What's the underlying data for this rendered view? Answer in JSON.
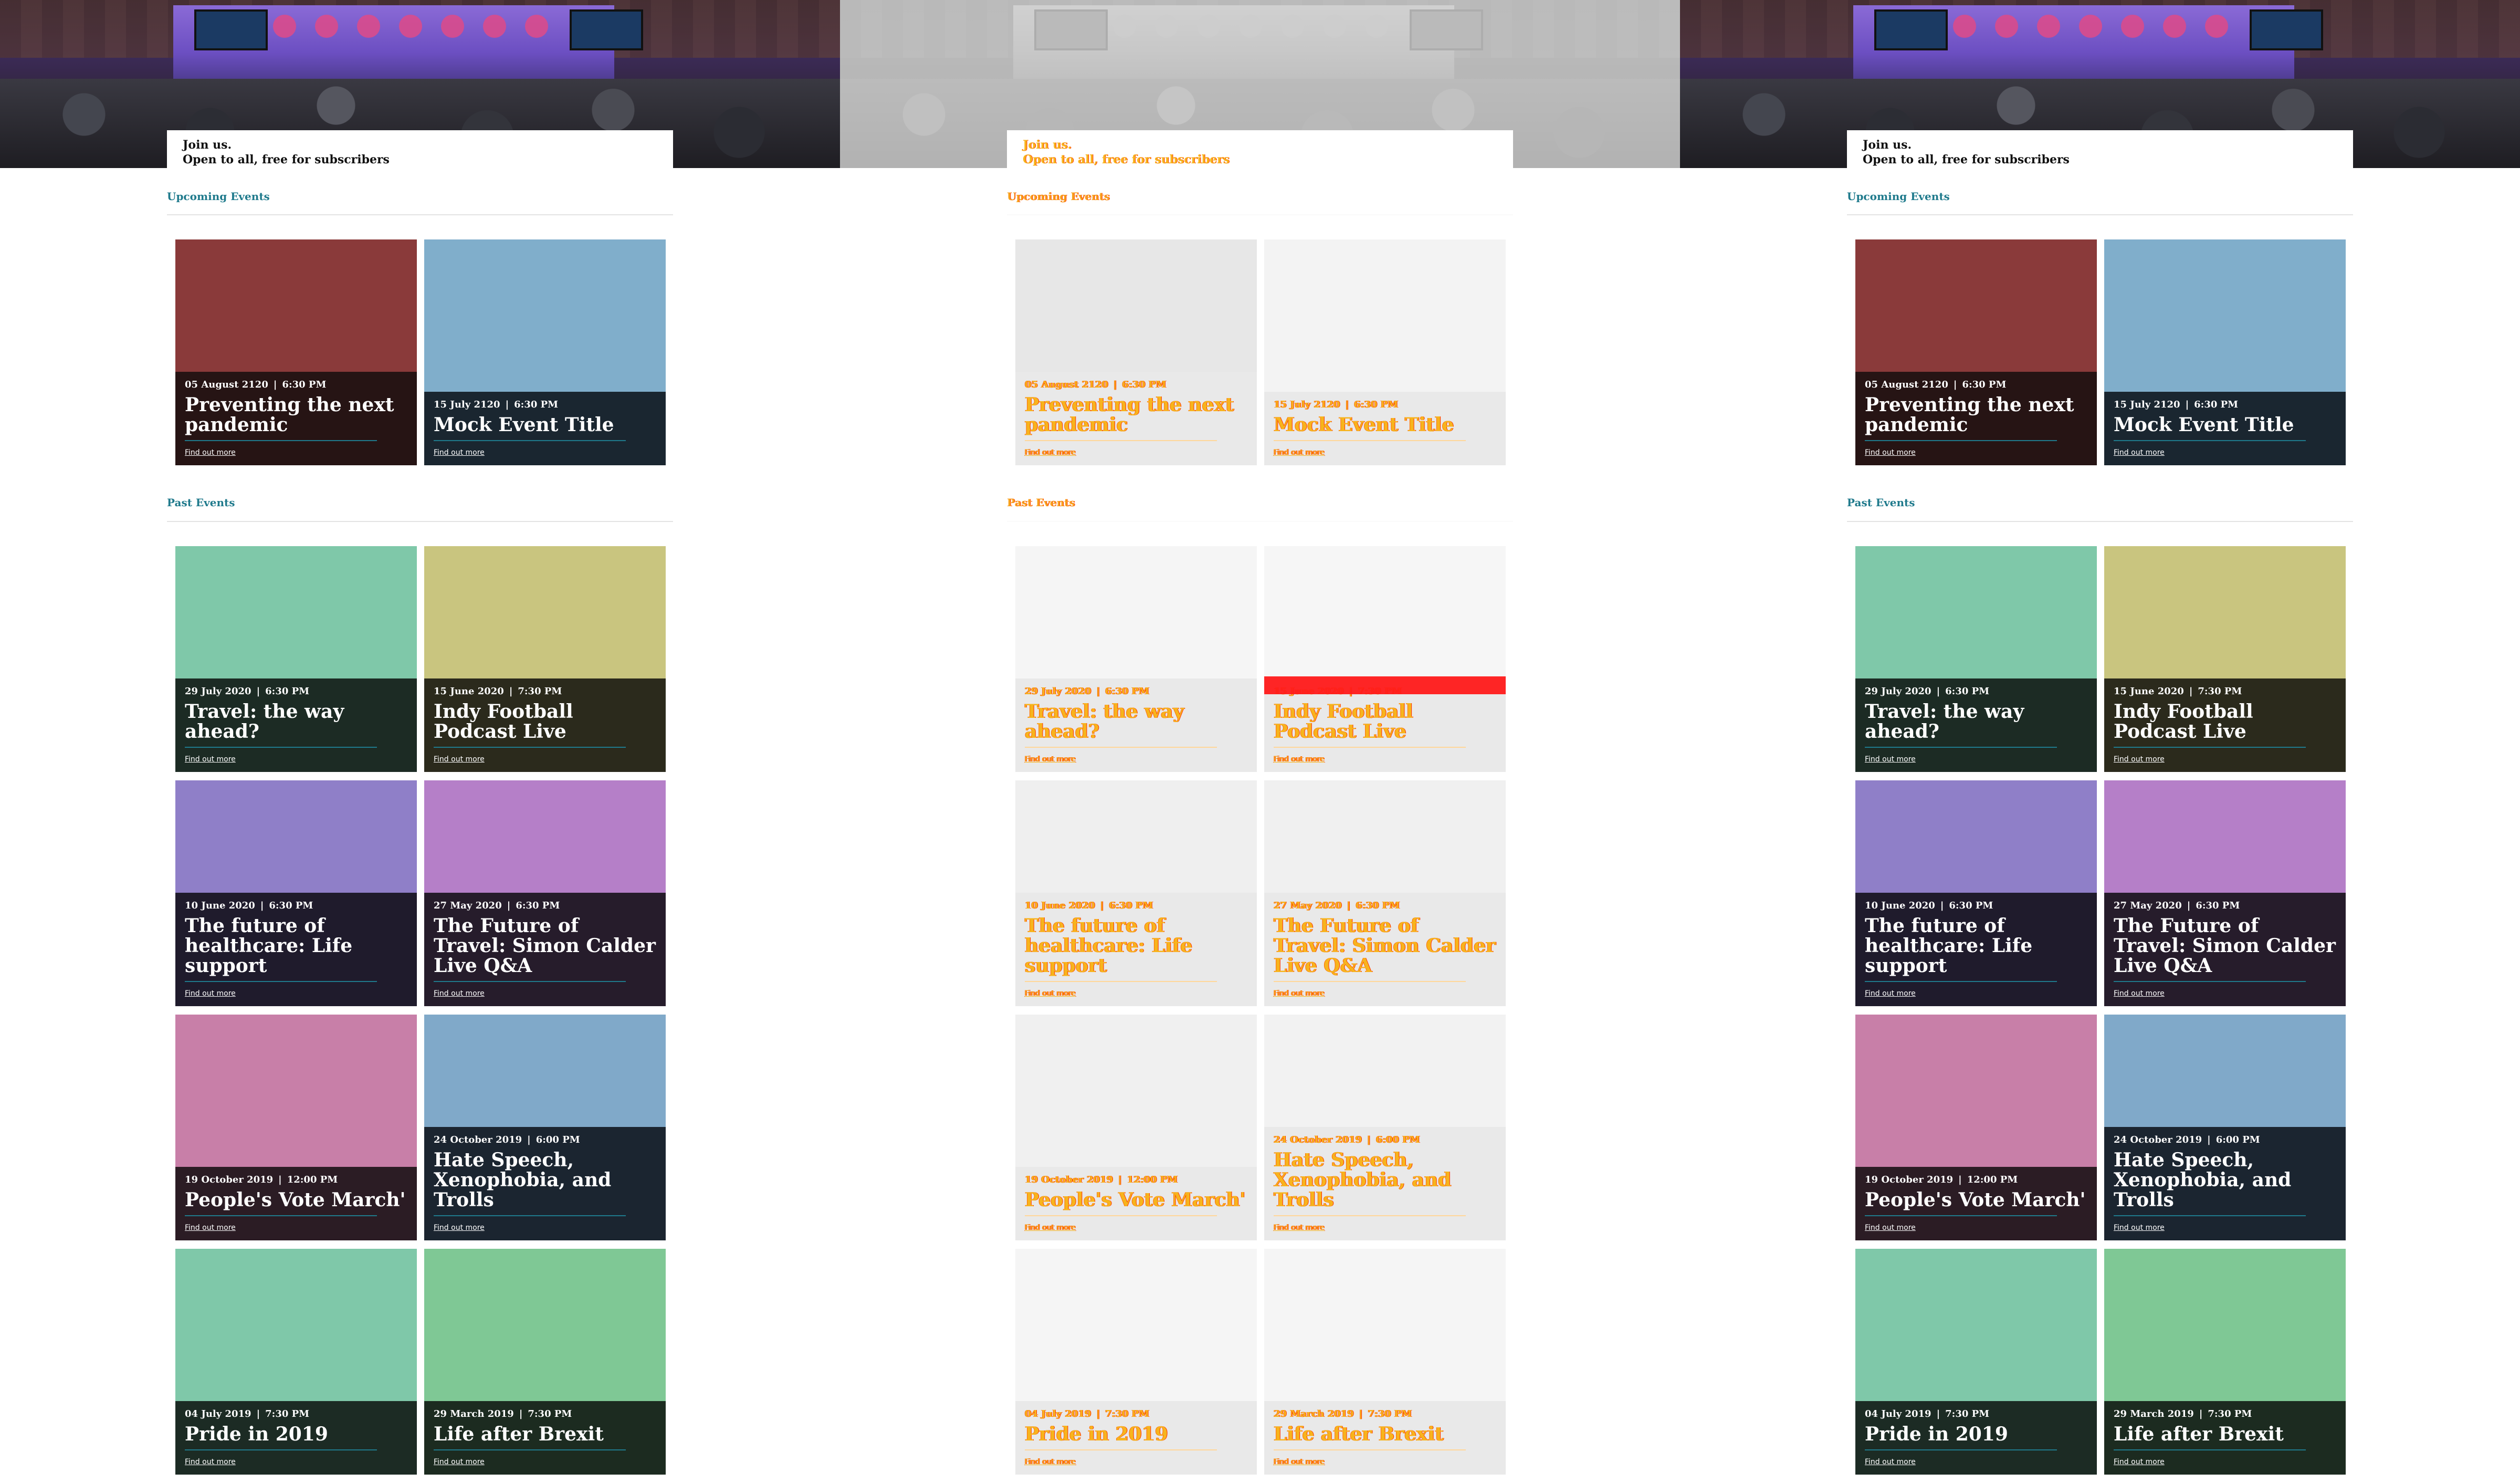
{
  "hero": {
    "join_title": "Join us.",
    "join_subtitle": "Open to all, free for subscribers"
  },
  "sections": {
    "upcoming": "Upcoming Events",
    "past": "Past Events"
  },
  "link_label": "Find out more",
  "upcoming_events": [
    {
      "date": "05 August 2120",
      "time": "6:30 PM",
      "title": "Preventing the next pandemic",
      "color": "#8a3a3a",
      "info_bg": "#261414"
    },
    {
      "date": "15 July 2120",
      "time": "6:30 PM",
      "title": "Mock Event Title",
      "color": "#80aecb",
      "info_bg": "#1a2630"
    }
  ],
  "past_events": [
    {
      "date": "29 July 2020",
      "time": "6:30 PM",
      "title": "Travel: the way ahead?",
      "color": "#7fc8a9",
      "info_bg": "#1c2b24"
    },
    {
      "date": "15 June 2020",
      "time": "7:30 PM",
      "title": "Indy Football Podcast Live",
      "color": "#c9c57f",
      "info_bg": "#2b2a1c"
    },
    {
      "date": "10 June 2020",
      "time": "6:30 PM",
      "title": "The future of healthcare: Life support",
      "color": "#8f7fc8",
      "info_bg": "#1f1b2c"
    },
    {
      "date": "27 May 2020",
      "time": "6:30 PM",
      "title": "The Future of Travel: Simon Calder Live Q&A",
      "color": "#b57fc8",
      "info_bg": "#261c2b"
    },
    {
      "date": "19 October 2019",
      "time": "12:00 PM",
      "title": "People's Vote March'",
      "color": "#c87fa8",
      "info_bg": "#2b1c24"
    },
    {
      "date": "24 October 2019",
      "time": "6:00 PM",
      "title": "Hate Speech, Xenophobia, and Trolls",
      "color": "#80a9c9",
      "info_bg": "#1b2530"
    },
    {
      "date": "04 July 2019",
      "time": "7:30 PM",
      "title": "Pride in 2019",
      "color": "#7fc8a9",
      "info_bg": "#1c2b24"
    },
    {
      "date": "29 March 2019",
      "time": "7:30 PM",
      "title": "Life after Brexit",
      "color": "#7fc895",
      "info_bg": "#1c2b20"
    }
  ],
  "colors": {
    "accent": "#1f7a8c",
    "diff_highlight": "#f7b41d",
    "diff_red": "#ff1a1a"
  }
}
